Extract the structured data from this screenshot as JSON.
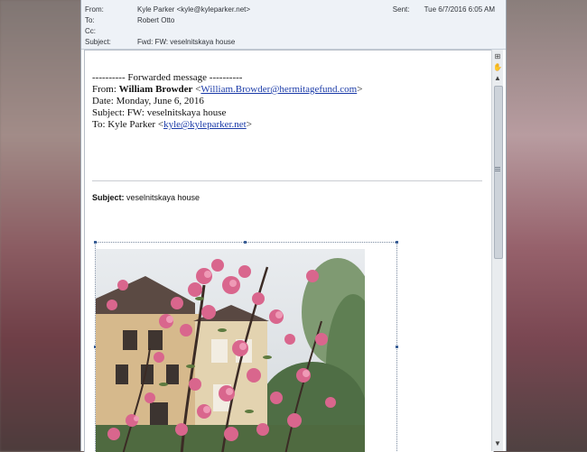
{
  "header": {
    "from_label": "From:",
    "from_value": "Kyle Parker <kyle@kyleparker.net>",
    "to_label": "To:",
    "to_value": "Robert Otto",
    "cc_label": "Cc:",
    "cc_value": "",
    "subject_label": "Subject:",
    "subject_value": "Fwd: FW: veselnitskaya house",
    "sent_label": "Sent:",
    "sent_value": "Tue 6/7/2016 6:05 AM"
  },
  "body": {
    "forward_marker": "---------- Forwarded message ----------",
    "from_prefix": "From: ",
    "from_name": "William Browder",
    "from_email": "William.Browder@hermitagefund.com",
    "date_line": "Date: Monday, June 6, 2016",
    "subject_line": "Subject: FW: veselnitskaya house",
    "to_prefix": "To: Kyle Parker <",
    "to_email": "kyle@kyleparker.net",
    "inner_subject_label": "Subject:",
    "inner_subject_value": " veselnitskaya house"
  },
  "scrollbar": {
    "up_icon": "arrow-up-icon",
    "down_icon": "arrow-down-icon",
    "position": 0.0
  }
}
